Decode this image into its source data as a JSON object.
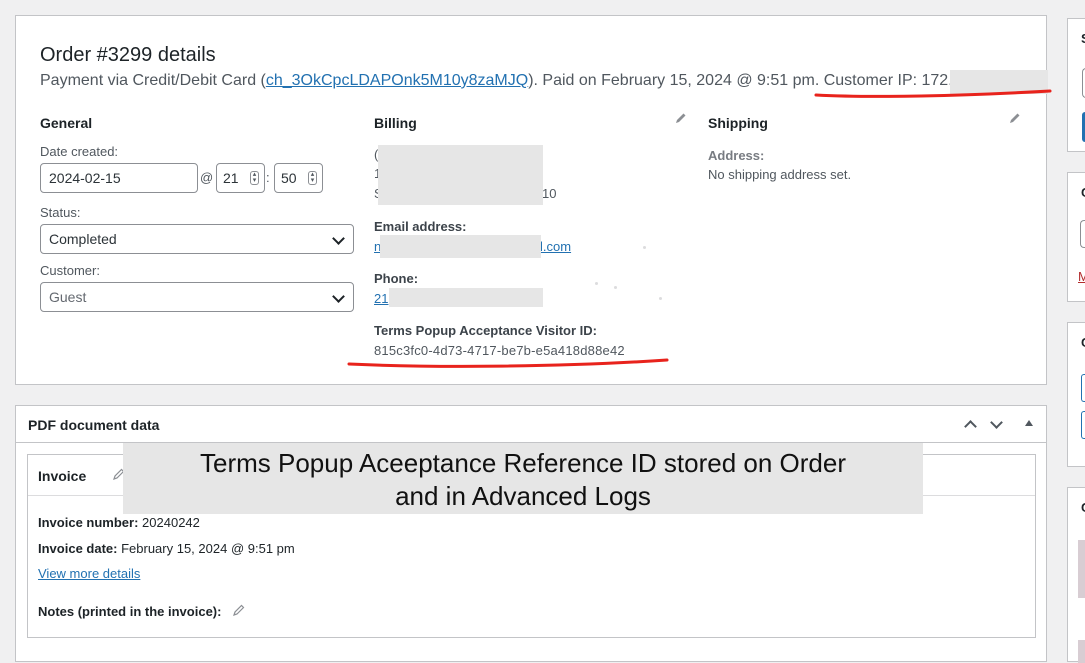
{
  "order": {
    "title": "Order #3299 details",
    "payment_prefix": "Payment via Credit/Debit Card (",
    "transaction_id": "ch_3OkCpcLDAPOnk5M10y8zaMJQ",
    "payment_suffix": "). Paid on February 15, 2024 @ 9:51 pm. Customer IP: 172."
  },
  "general": {
    "heading": "General",
    "date_label": "Date created:",
    "date_value": "2024-02-15",
    "at": "@",
    "hour": "21",
    "colon": ":",
    "minute": "50",
    "status_label": "Status:",
    "status_value": "Completed",
    "customer_label": "Customer:",
    "customer_value": "Guest"
  },
  "billing": {
    "heading": "Billing",
    "address_fragment_1": "(",
    "address_fragment_2": "1",
    "address_fragment_3": "S",
    "address_fragment_4": "10",
    "email_label": "Email address:",
    "email_start": "n",
    "email_end": "l.com",
    "phone_label": "Phone:",
    "phone_value": "21",
    "terms_label": "Terms Popup Acceptance Visitor ID:",
    "terms_value": "815c3fc0-4d73-4717-be7b-e5a418d88e42"
  },
  "shipping": {
    "heading": "Shipping",
    "address_label": "Address:",
    "address_value": "No shipping address set."
  },
  "pdf": {
    "heading": "PDF document data",
    "invoice_title": "Invoice",
    "invoice_number_label": "Invoice number:",
    "invoice_number_value": "20240242",
    "invoice_date_label": "Invoice date:",
    "invoice_date_value": "February 15, 2024 @ 9:51 pm",
    "view_more": "View more details",
    "notes_label": "Notes (printed in the invoice):"
  },
  "overlay": {
    "line1": "Terms Popup Aceeptance Reference ID stored on Order",
    "line2": "and in Advanced Logs"
  },
  "sidebar": {
    "box1_letter": "S",
    "box2_letter": "C",
    "box2_link": "M",
    "box3_letter": "C",
    "box4_letter": "C"
  },
  "colors": {
    "accent": "#2271b1",
    "annotation_red": "#e8231c",
    "redaction": "#e6e6e6"
  }
}
